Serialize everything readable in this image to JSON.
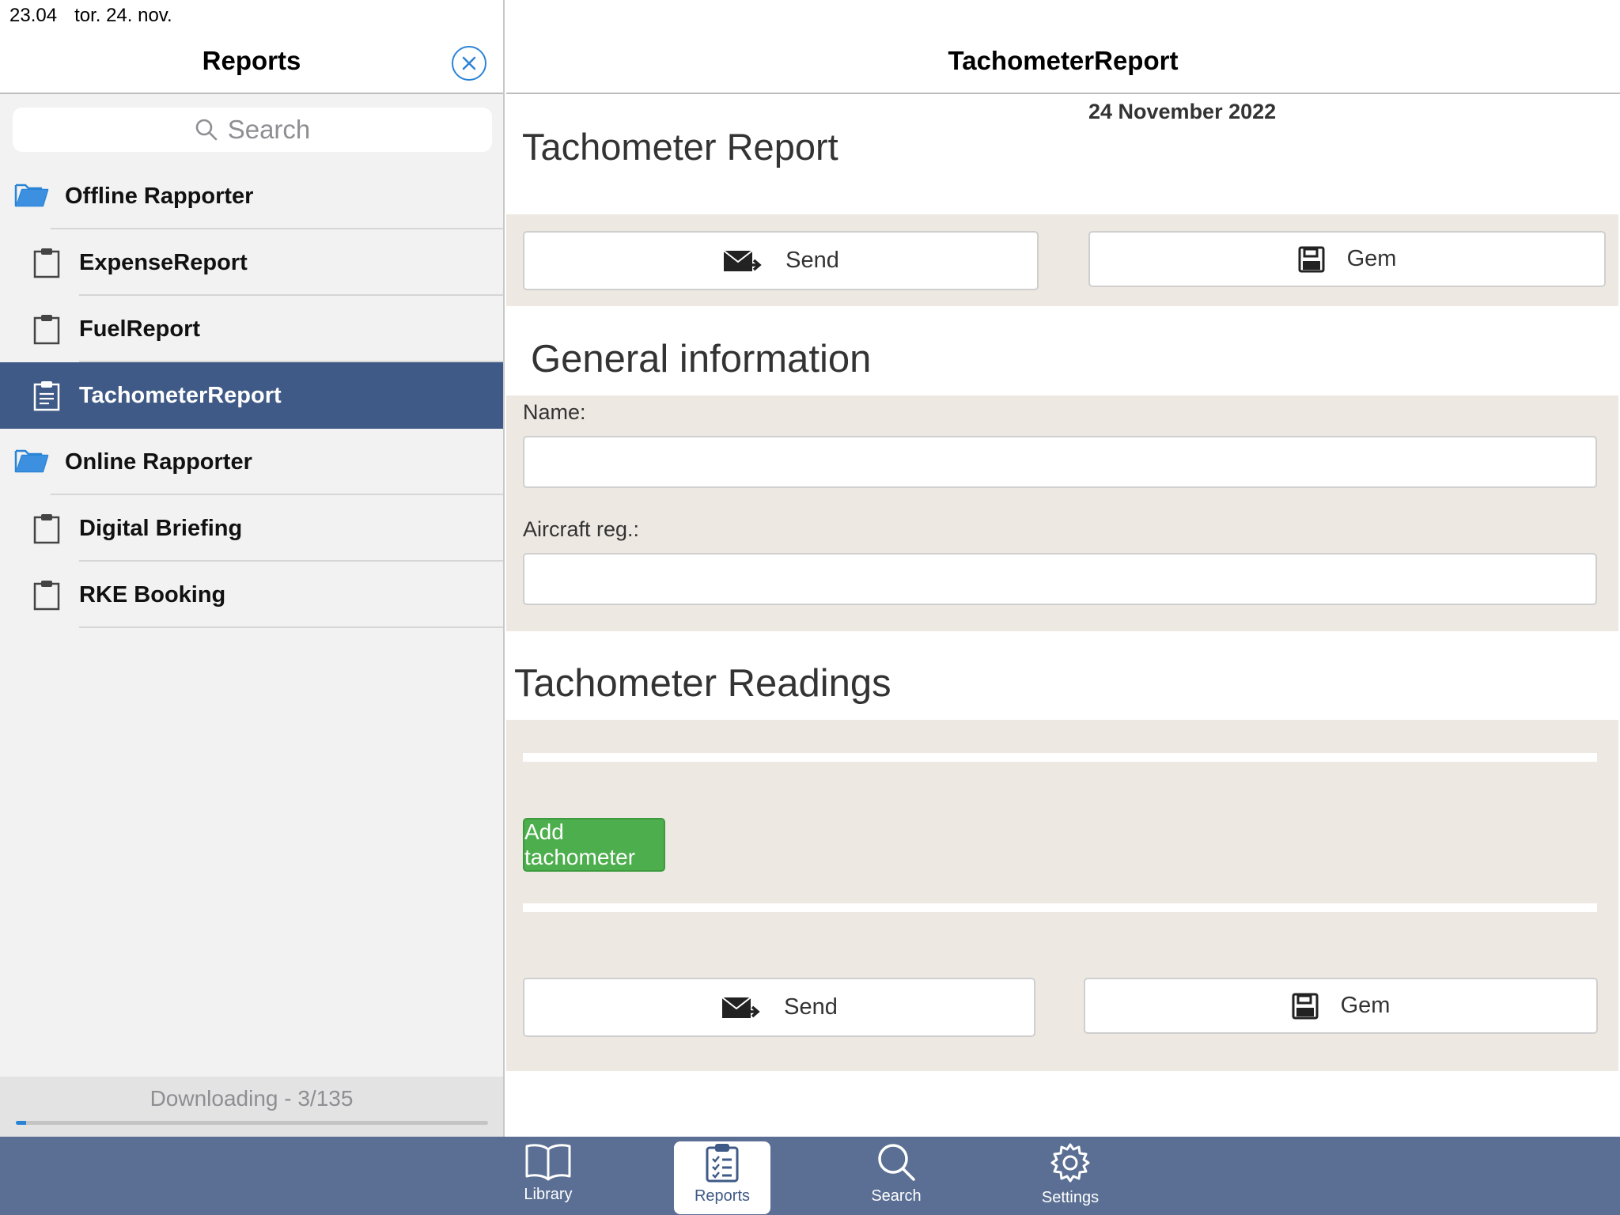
{
  "status_bar": {
    "time": "23.04",
    "date": "tor. 24. nov."
  },
  "sidebar": {
    "title": "Reports",
    "search_placeholder": "Search",
    "rows": [
      {
        "type": "folder",
        "label": "Offline Rapporter",
        "icon": "folder-open-icon"
      },
      {
        "type": "item",
        "label": "ExpenseReport",
        "icon": "clipboard-icon"
      },
      {
        "type": "item",
        "label": "FuelReport",
        "icon": "clipboard-icon"
      },
      {
        "type": "item",
        "label": "TachometerReport",
        "icon": "clipboard-list-icon",
        "selected": true
      },
      {
        "type": "folder",
        "label": "Online Rapporter",
        "icon": "folder-open-icon"
      },
      {
        "type": "item",
        "label": "Digital Briefing",
        "icon": "clipboard-icon"
      },
      {
        "type": "item",
        "label": "RKE Booking",
        "icon": "clipboard-icon"
      }
    ],
    "download": {
      "text": "Downloading - 3/135",
      "progress_fraction": 0.022
    }
  },
  "main": {
    "header_title": "TachometerReport",
    "date": "24 November 2022",
    "report_title": "Tachometer Report",
    "send_label": "Send",
    "save_label": "Gem",
    "general_heading": "General information",
    "name_label": "Name:",
    "aircraft_label": "Aircraft reg.:",
    "readings_heading": "Tachometer Readings",
    "add_tachometer_label": "Add tachometer"
  },
  "tabbar": {
    "tabs": [
      {
        "label": "Library",
        "icon": "book-icon"
      },
      {
        "label": "Reports",
        "icon": "clipboard-checklist-icon",
        "active": true
      },
      {
        "label": "Search",
        "icon": "search-icon"
      },
      {
        "label": "Settings",
        "icon": "gear-icon"
      }
    ]
  },
  "colors": {
    "accent": "#2a84d6",
    "selected_row": "#3f5a86",
    "tabbar": "#5a6f93",
    "form_background": "#ede9e2",
    "success_button": "#4cae4c"
  }
}
